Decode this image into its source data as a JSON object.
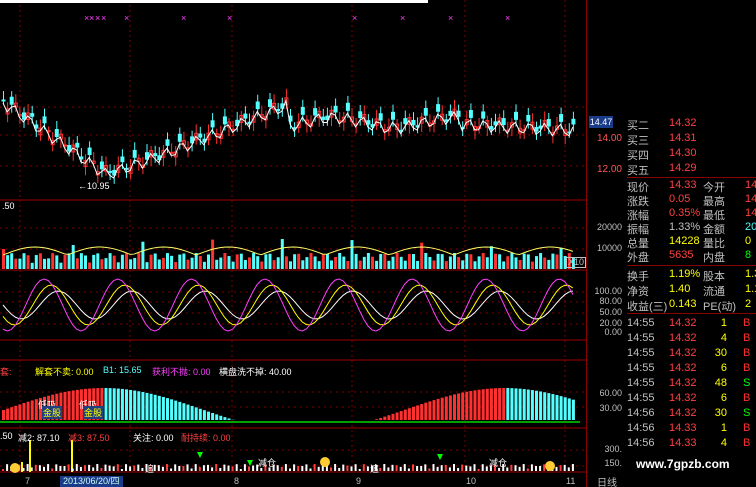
{
  "chart": {
    "low_marker": "←10.95",
    "y_main_labels": [
      "14.00",
      "12.00"
    ],
    "current_price_tag": "14.47",
    "vol_panel_label": ".50",
    "vol_y_labels": [
      "20000",
      "10000"
    ],
    "vol_unit": "X10",
    "kdj_y_labels": [
      "100.00",
      "80.00",
      "50.00",
      "20.00",
      "0.00"
    ],
    "ind3_header": {
      "a": "套:",
      "b": "解套不卖: 0.00",
      "c": "B1: 15.65",
      "d": "获利不抛: 0.00",
      "e": "横盘洗不掉: 40.00"
    },
    "ind3_y_labels": [
      "60.00",
      "30.00"
    ],
    "ind3_tags": [
      "低吸",
      "金股",
      "低吸",
      "金股"
    ],
    "ind4_header": {
      "a": ".50",
      "b": "减2: 87.10",
      "c": "减3: 87.50",
      "d": "关注: 0.00",
      "e": "耐持续: 0.00"
    },
    "ind4_y_labels": [
      "300.",
      "150.",
      "0.00"
    ],
    "ind4_tags": [
      "追",
      "减仓",
      "追",
      "减仓"
    ],
    "date_tag": "2013/06/20/四",
    "x_ticks": [
      "7",
      "8",
      "9",
      "10",
      "11"
    ]
  },
  "quotes": {
    "levels": [
      {
        "label": "买二",
        "value": "14.32",
        "volume": ""
      },
      {
        "label": "买三",
        "value": "14.31",
        "volume": ""
      },
      {
        "label": "买四",
        "value": "14.30",
        "volume": ""
      },
      {
        "label": "买五",
        "value": "14.29",
        "volume": ""
      }
    ],
    "stats": [
      {
        "l1": "现价",
        "v1": "14.33",
        "l2": "今开",
        "v2": "14"
      },
      {
        "l1": "涨跌",
        "v1": "0.05",
        "l2": "最高",
        "v2": "14"
      },
      {
        "l1": "涨幅",
        "v1": "0.35%",
        "l2": "最低",
        "v2": "14"
      },
      {
        "l1": "振幅",
        "v1": "1.33%",
        "l2": "金额",
        "v2": "204"
      },
      {
        "l1": "总量",
        "v1": "14228",
        "l2": "量比",
        "v2": "0"
      },
      {
        "l1": "外盘",
        "v1": "5635",
        "l2": "内盘",
        "v2": "8"
      }
    ],
    "stats2": [
      {
        "l1": "换手",
        "v1": "1.19%",
        "l2": "股本",
        "v2": "1.3"
      },
      {
        "l1": "净资",
        "v1": "1.40",
        "l2": "流通",
        "v2": "1.1"
      },
      {
        "l1": "收益(三)",
        "v1": "0.143",
        "l2": "PE(动)",
        "v2": "2"
      }
    ],
    "ticks": [
      {
        "time": "14:55",
        "price": "14.32",
        "vol": "1",
        "side": "B"
      },
      {
        "time": "14:55",
        "price": "14.32",
        "vol": "4",
        "side": "B"
      },
      {
        "time": "14:55",
        "price": "14.32",
        "vol": "30",
        "side": "B"
      },
      {
        "time": "14:55",
        "price": "14.32",
        "vol": "6",
        "side": "B"
      },
      {
        "time": "14:55",
        "price": "14.32",
        "vol": "48",
        "side": "S"
      },
      {
        "time": "14:55",
        "price": "14.32",
        "vol": "6",
        "side": "B"
      },
      {
        "time": "14:56",
        "price": "14.32",
        "vol": "30",
        "side": "S"
      },
      {
        "time": "14:56",
        "price": "14.33",
        "vol": "1",
        "side": "B"
      },
      {
        "time": "14:56",
        "price": "14.33",
        "vol": "4",
        "side": "B"
      }
    ],
    "footer_label": "日线"
  },
  "watermark": "www.7gpzb.com",
  "colors": {
    "up": "#ff3030",
    "down": "#54ffff",
    "grid": "#800000",
    "sell": "#00ff00"
  }
}
